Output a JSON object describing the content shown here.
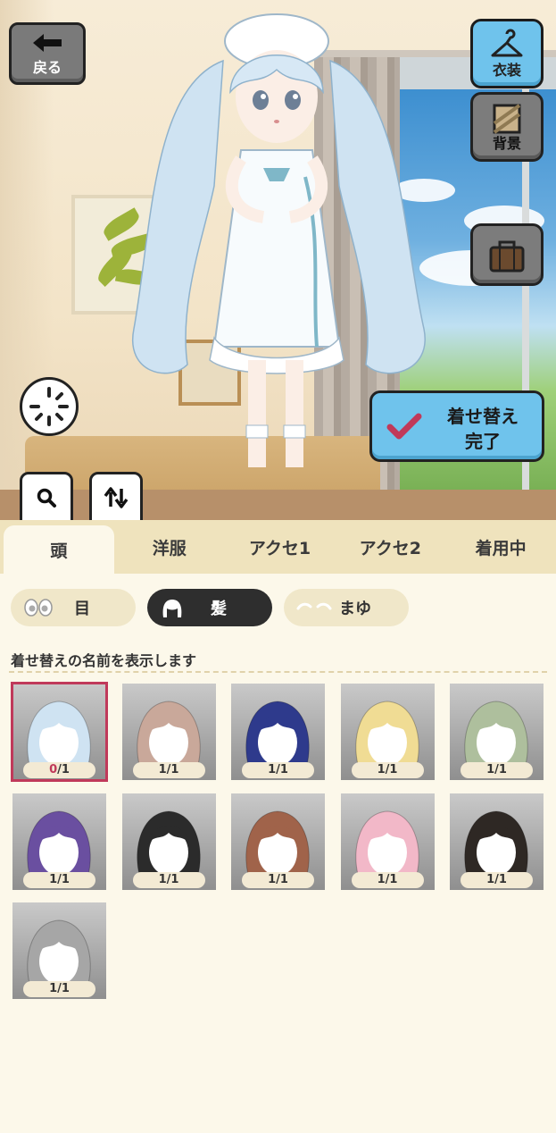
{
  "header": {
    "back_label": "戻る"
  },
  "side_menu": {
    "costume_label": "衣装",
    "background_label": "背景"
  },
  "done_button": {
    "line1": "着せ替え",
    "line2": "完了"
  },
  "tabs": [
    {
      "label": "頭",
      "active": true
    },
    {
      "label": "洋服",
      "active": false
    },
    {
      "label": "アクセ1",
      "active": false
    },
    {
      "label": "アクセ2",
      "active": false
    },
    {
      "label": "着用中",
      "active": false
    }
  ],
  "subcategories": [
    {
      "label": "目",
      "icon": "eye-icon",
      "active": false
    },
    {
      "label": "髪",
      "icon": "hair-icon",
      "active": true
    },
    {
      "label": "まゆ",
      "icon": "eyebrow-icon",
      "active": false
    }
  ],
  "hint_text": "着せ替えの名前を表示します",
  "hair_items": [
    {
      "count_owned": "0",
      "count_total": "1",
      "hair_color": "#cfe3f2",
      "selected": true
    },
    {
      "count_owned": "1",
      "count_total": "1",
      "hair_color": "#c9a89a",
      "selected": false
    },
    {
      "count_owned": "1",
      "count_total": "1",
      "hair_color": "#2e3a8c",
      "selected": false
    },
    {
      "count_owned": "1",
      "count_total": "1",
      "hair_color": "#f0dc94",
      "selected": false
    },
    {
      "count_owned": "1",
      "count_total": "1",
      "hair_color": "#aebf9d",
      "selected": false
    },
    {
      "count_owned": "1",
      "count_total": "1",
      "hair_color": "#6a4fa0",
      "selected": false
    },
    {
      "count_owned": "1",
      "count_total": "1",
      "hair_color": "#2b2b2b",
      "selected": false
    },
    {
      "count_owned": "1",
      "count_total": "1",
      "hair_color": "#a0634a",
      "selected": false
    },
    {
      "count_owned": "1",
      "count_total": "1",
      "hair_color": "#f2b8c8",
      "selected": false
    },
    {
      "count_owned": "1",
      "count_total": "1",
      "hair_color": "#2e2824",
      "selected": false
    },
    {
      "count_owned": "1",
      "count_total": "1",
      "hair_color": "#a6a6a6",
      "selected": false
    }
  ],
  "colors": {
    "accent_blue": "#6fc3ec",
    "selected_outline": "#c0395a",
    "panel_bg": "#fcf8ea",
    "tab_bar_bg": "#efe3bd"
  }
}
